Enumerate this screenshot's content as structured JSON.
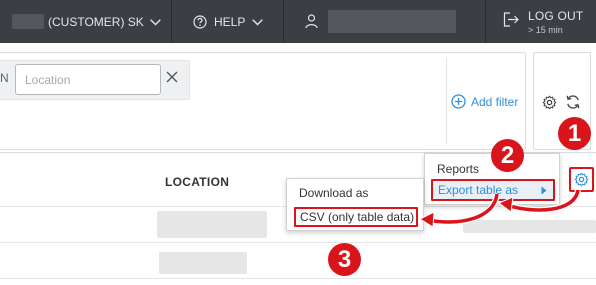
{
  "topbar": {
    "customer_label": "(CUSTOMER) SK",
    "help_label": "HELP",
    "logout_label": "LOG OUT",
    "logout_timer": "> 15 min"
  },
  "filters": {
    "chip_fragment": "N",
    "location_placeholder": "Location",
    "add_filter_label": "Add filter"
  },
  "table": {
    "columns": [
      "LOCATION"
    ]
  },
  "column_menu": {
    "items": [
      "Reports",
      "Export table as"
    ]
  },
  "export_submenu": {
    "items": [
      "Download as",
      "CSV (only table data)"
    ]
  },
  "annotations": {
    "steps": [
      "1",
      "2",
      "3"
    ],
    "color": "#d9141b"
  },
  "colors": {
    "topbar_bg": "#3b3e43",
    "accent": "#2f8fd8",
    "highlight": "#d9141b"
  },
  "icons": {
    "customer_caret": "chevron-down-icon",
    "help": "help-circle-icon",
    "user": "user-icon",
    "logout": "logout-icon",
    "clear": "close-icon",
    "add_filter": "plus-circle-icon",
    "settings": "gear-icon",
    "refresh": "refresh-icon",
    "submenu": "chevron-right-icon"
  }
}
